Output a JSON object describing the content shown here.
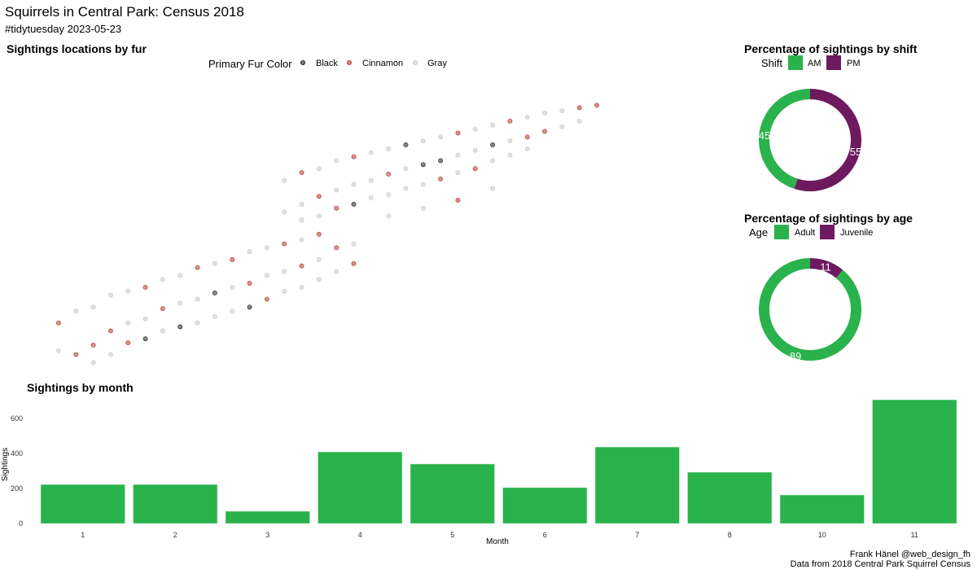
{
  "title": "Squirrels in Central Park: Census 2018",
  "subtitle": "#tidytuesday 2023-05-23",
  "caption_line1": "Frank Hänel @web_design_fh",
  "caption_line2": "Data from 2018 Central Park Squirrel Census",
  "colors": {
    "green": "#2ab24c",
    "purple": "#6d1a5e",
    "Black": "#222222",
    "Cinnamon": "#b5362f",
    "Gray": "#c8c8c8"
  },
  "chart_data": [
    {
      "type": "scatter",
      "title": "Sightings locations by fur",
      "legend_title": "Primary Fur Color",
      "legend": [
        "Black",
        "Cinnamon",
        "Gray"
      ],
      "legend_placement": "top",
      "grid": false,
      "x_range": [
        -73.9825,
        -73.9485
      ],
      "y_range": [
        40.764,
        40.8
      ],
      "points": [
        [
          -73.981,
          40.77,
          "Cinnamon"
        ],
        [
          -73.981,
          40.7665,
          "Gray"
        ],
        [
          -73.98,
          40.7715,
          "Gray"
        ],
        [
          -73.98,
          40.766,
          "Cinnamon"
        ],
        [
          -73.979,
          40.772,
          "Gray"
        ],
        [
          -73.979,
          40.7672,
          "Cinnamon"
        ],
        [
          -73.979,
          40.765,
          "Gray"
        ],
        [
          -73.978,
          40.7735,
          "Gray"
        ],
        [
          -73.978,
          40.769,
          "Cinnamon"
        ],
        [
          -73.978,
          40.766,
          "Gray"
        ],
        [
          -73.977,
          40.774,
          "Gray"
        ],
        [
          -73.977,
          40.77,
          "Gray"
        ],
        [
          -73.977,
          40.7675,
          "Cinnamon"
        ],
        [
          -73.976,
          40.7745,
          "Cinnamon"
        ],
        [
          -73.976,
          40.7705,
          "Gray"
        ],
        [
          -73.976,
          40.768,
          "Black"
        ],
        [
          -73.975,
          40.7755,
          "Gray"
        ],
        [
          -73.975,
          40.7718,
          "Cinnamon"
        ],
        [
          -73.975,
          40.769,
          "Gray"
        ],
        [
          -73.974,
          40.776,
          "Gray"
        ],
        [
          -73.974,
          40.7725,
          "Gray"
        ],
        [
          -73.974,
          40.7695,
          "Black"
        ],
        [
          -73.973,
          40.777,
          "Cinnamon"
        ],
        [
          -73.973,
          40.773,
          "Gray"
        ],
        [
          -73.973,
          40.77,
          "Gray"
        ],
        [
          -73.972,
          40.7775,
          "Gray"
        ],
        [
          -73.972,
          40.7738,
          "Black"
        ],
        [
          -73.972,
          40.7708,
          "Gray"
        ],
        [
          -73.971,
          40.778,
          "Cinnamon"
        ],
        [
          -73.971,
          40.7745,
          "Gray"
        ],
        [
          -73.971,
          40.7715,
          "Gray"
        ],
        [
          -73.97,
          40.779,
          "Gray"
        ],
        [
          -73.97,
          40.775,
          "Cinnamon"
        ],
        [
          -73.97,
          40.772,
          "Black"
        ],
        [
          -73.969,
          40.7795,
          "Gray"
        ],
        [
          -73.969,
          40.776,
          "Gray"
        ],
        [
          -73.969,
          40.773,
          "Cinnamon"
        ],
        [
          -73.968,
          40.78,
          "Cinnamon"
        ],
        [
          -73.968,
          40.7765,
          "Gray"
        ],
        [
          -73.968,
          40.774,
          "Gray"
        ],
        [
          -73.967,
          40.7805,
          "Gray"
        ],
        [
          -73.967,
          40.7772,
          "Cinnamon"
        ],
        [
          -73.967,
          40.7745,
          "Gray"
        ],
        [
          -73.966,
          40.7812,
          "Cinnamon"
        ],
        [
          -73.966,
          40.778,
          "Gray"
        ],
        [
          -73.966,
          40.7755,
          "Gray"
        ],
        [
          -73.965,
          40.7795,
          "Cinnamon"
        ],
        [
          -73.965,
          40.7765,
          "Gray"
        ],
        [
          -73.964,
          40.78,
          "Gray"
        ],
        [
          -73.964,
          40.7775,
          "Cinnamon"
        ],
        [
          -73.968,
          40.788,
          "Gray"
        ],
        [
          -73.968,
          40.784,
          "Gray"
        ],
        [
          -73.967,
          40.789,
          "Cinnamon"
        ],
        [
          -73.967,
          40.785,
          "Gray"
        ],
        [
          -73.967,
          40.783,
          "Gray"
        ],
        [
          -73.966,
          40.7895,
          "Gray"
        ],
        [
          -73.966,
          40.786,
          "Cinnamon"
        ],
        [
          -73.966,
          40.7835,
          "Gray"
        ],
        [
          -73.965,
          40.7905,
          "Gray"
        ],
        [
          -73.965,
          40.7868,
          "Gray"
        ],
        [
          -73.965,
          40.7845,
          "Cinnamon"
        ],
        [
          -73.964,
          40.791,
          "Cinnamon"
        ],
        [
          -73.964,
          40.7875,
          "Gray"
        ],
        [
          -73.964,
          40.785,
          "Black"
        ],
        [
          -73.963,
          40.7915,
          "Gray"
        ],
        [
          -73.963,
          40.788,
          "Gray"
        ],
        [
          -73.963,
          40.7858,
          "Gray"
        ],
        [
          -73.962,
          40.792,
          "Gray"
        ],
        [
          -73.962,
          40.7888,
          "Cinnamon"
        ],
        [
          -73.962,
          40.7862,
          "Gray"
        ],
        [
          -73.961,
          40.7925,
          "Black"
        ],
        [
          -73.961,
          40.7895,
          "Gray"
        ],
        [
          -73.961,
          40.787,
          "Gray"
        ],
        [
          -73.96,
          40.793,
          "Gray"
        ],
        [
          -73.96,
          40.79,
          "Black"
        ],
        [
          -73.96,
          40.7875,
          "Gray"
        ],
        [
          -73.959,
          40.7935,
          "Gray"
        ],
        [
          -73.959,
          40.7905,
          "Black"
        ],
        [
          -73.959,
          40.7882,
          "Cinnamon"
        ],
        [
          -73.958,
          40.794,
          "Cinnamon"
        ],
        [
          -73.958,
          40.7912,
          "Gray"
        ],
        [
          -73.958,
          40.789,
          "Gray"
        ],
        [
          -73.957,
          40.7945,
          "Gray"
        ],
        [
          -73.957,
          40.7918,
          "Gray"
        ],
        [
          -73.957,
          40.7895,
          "Cinnamon"
        ],
        [
          -73.956,
          40.795,
          "Gray"
        ],
        [
          -73.956,
          40.7925,
          "Black"
        ],
        [
          -73.956,
          40.7905,
          "Gray"
        ],
        [
          -73.955,
          40.7955,
          "Cinnamon"
        ],
        [
          -73.955,
          40.793,
          "Gray"
        ],
        [
          -73.955,
          40.7912,
          "Gray"
        ],
        [
          -73.954,
          40.796,
          "Gray"
        ],
        [
          -73.954,
          40.7935,
          "Cinnamon"
        ],
        [
          -73.954,
          40.792,
          "Gray"
        ],
        [
          -73.953,
          40.7965,
          "Gray"
        ],
        [
          -73.953,
          40.7942,
          "Cinnamon"
        ],
        [
          -73.952,
          40.7968,
          "Gray"
        ],
        [
          -73.952,
          40.7948,
          "Gray"
        ],
        [
          -73.951,
          40.7972,
          "Cinnamon"
        ],
        [
          -73.951,
          40.7955,
          "Gray"
        ],
        [
          -73.95,
          40.7975,
          "Cinnamon"
        ],
        [
          -73.962,
          40.7835,
          "Gray"
        ],
        [
          -73.96,
          40.7845,
          "Gray"
        ],
        [
          -73.958,
          40.7855,
          "Cinnamon"
        ],
        [
          -73.956,
          40.787,
          "Gray"
        ]
      ]
    },
    {
      "type": "pie",
      "title": "Percentage of sightings by shift",
      "legend_title": "Shift",
      "legend": [
        "AM",
        "PM"
      ],
      "slices": [
        {
          "label": "PM",
          "value": 55
        },
        {
          "label": "AM",
          "value": 45
        }
      ]
    },
    {
      "type": "pie",
      "title": "Percentage of sightings by age",
      "legend_title": "Age",
      "legend": [
        "Adult",
        "Juvenile"
      ],
      "slices": [
        {
          "label": "Juvenile",
          "value": 11
        },
        {
          "label": "Adult",
          "value": 89
        }
      ]
    },
    {
      "type": "bar",
      "title": "Sightings by month",
      "xlabel": "Month",
      "ylabel": "Sightings",
      "ylim": [
        0,
        700
      ],
      "yticks": [
        "0",
        "200",
        "400",
        "600"
      ],
      "categories": [
        "1",
        "2",
        "3",
        "4",
        "5",
        "6",
        "7",
        "8",
        "10",
        "11"
      ],
      "values": [
        223,
        223,
        70,
        409,
        340,
        205,
        437,
        293,
        163,
        707
      ]
    }
  ]
}
